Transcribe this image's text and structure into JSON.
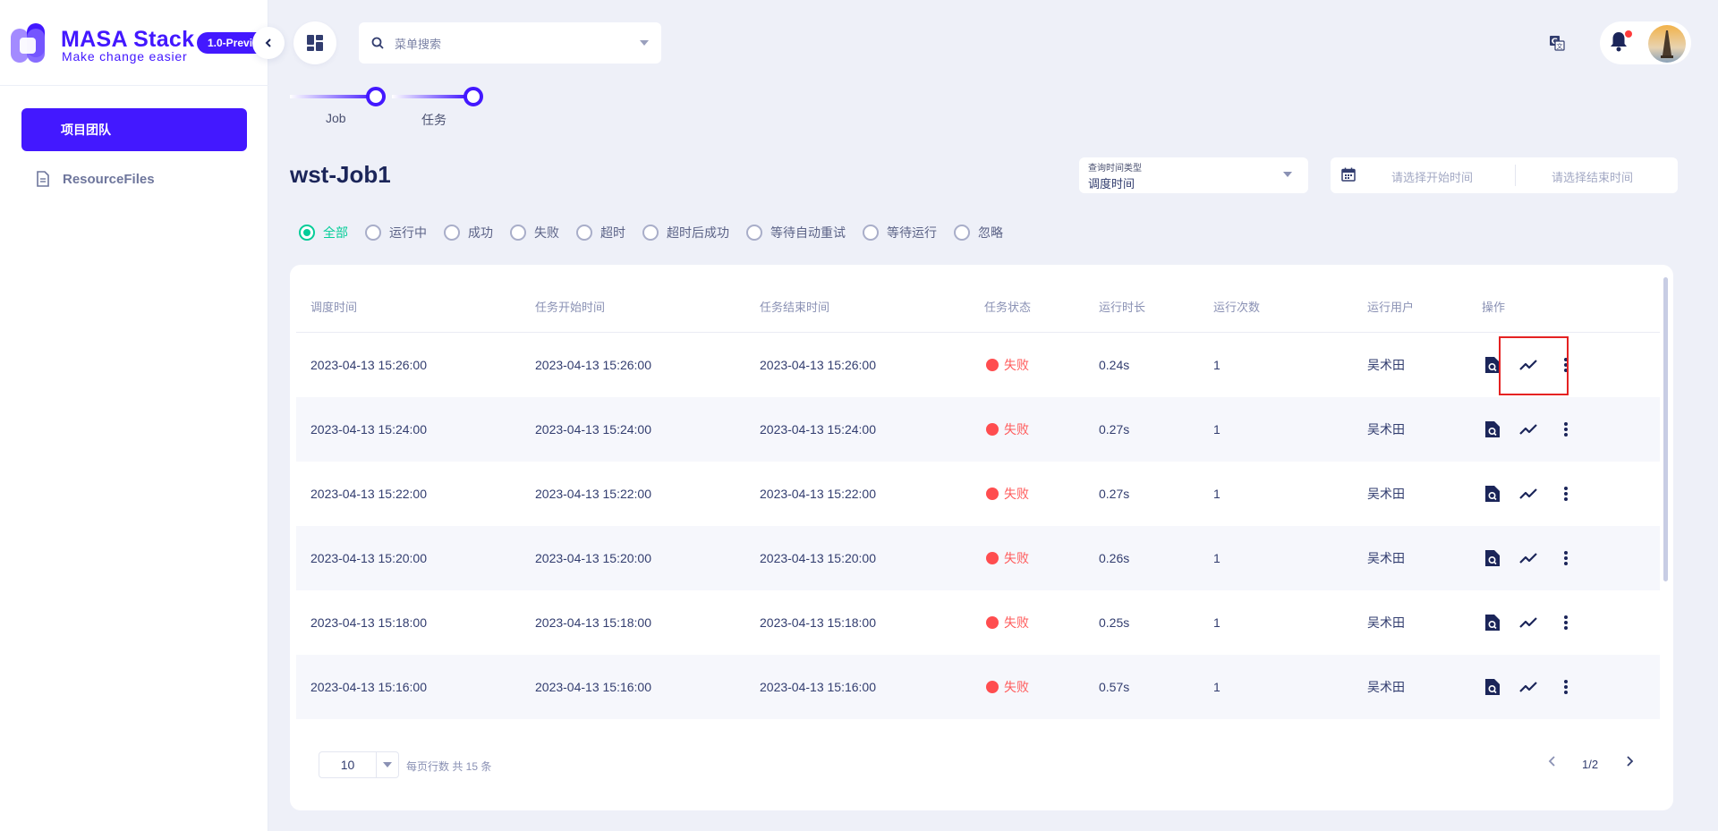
{
  "brand": {
    "name": "MASA Stack",
    "slogan": "Make change easier",
    "version": "1.0-Preview"
  },
  "sidebar": {
    "items": [
      {
        "label": "项目团队",
        "active": true
      },
      {
        "label": "ResourceFiles",
        "icon": "file-icon"
      }
    ]
  },
  "header": {
    "search_placeholder": "菜单搜索"
  },
  "stepper": {
    "steps": [
      "Job",
      "任务"
    ]
  },
  "page": {
    "title": "wst-Job1"
  },
  "filters": {
    "query_type_label": "查询时间类型",
    "query_type_value": "调度时间",
    "date_start_placeholder": "请选择开始时间",
    "date_end_placeholder": "请选择结束时间",
    "status_options": [
      "全部",
      "运行中",
      "成功",
      "失败",
      "超时",
      "超时后成功",
      "等待自动重试",
      "等待运行",
      "忽略"
    ],
    "status_selected": "全部"
  },
  "table": {
    "columns": [
      "调度时间",
      "任务开始时间",
      "任务结束时间",
      "任务状态",
      "运行时长",
      "运行次数",
      "运行用户",
      "操作"
    ],
    "rows": [
      {
        "schedule": "2023-04-13 15:26:00",
        "start": "2023-04-13 15:26:00",
        "end": "2023-04-13 15:26:00",
        "status": "失败",
        "duration": "0.24s",
        "count": "1",
        "user": "吴术田"
      },
      {
        "schedule": "2023-04-13 15:24:00",
        "start": "2023-04-13 15:24:00",
        "end": "2023-04-13 15:24:00",
        "status": "失败",
        "duration": "0.27s",
        "count": "1",
        "user": "吴术田"
      },
      {
        "schedule": "2023-04-13 15:22:00",
        "start": "2023-04-13 15:22:00",
        "end": "2023-04-13 15:22:00",
        "status": "失败",
        "duration": "0.27s",
        "count": "1",
        "user": "吴术田"
      },
      {
        "schedule": "2023-04-13 15:20:00",
        "start": "2023-04-13 15:20:00",
        "end": "2023-04-13 15:20:00",
        "status": "失败",
        "duration": "0.26s",
        "count": "1",
        "user": "吴术田"
      },
      {
        "schedule": "2023-04-13 15:18:00",
        "start": "2023-04-13 15:18:00",
        "end": "2023-04-13 15:18:00",
        "status": "失败",
        "duration": "0.25s",
        "count": "1",
        "user": "吴术田"
      },
      {
        "schedule": "2023-04-13 15:16:00",
        "start": "2023-04-13 15:16:00",
        "end": "2023-04-13 15:16:00",
        "status": "失败",
        "duration": "0.57s",
        "count": "1",
        "user": "吴术田"
      }
    ]
  },
  "pagination": {
    "page_size": "10",
    "info": "每页行数 共 15 条",
    "page": "1/2"
  },
  "colors": {
    "accent": "#4318ff",
    "success": "#05cd99",
    "failed": "#ff4d4f",
    "highlight": "#e52222"
  }
}
